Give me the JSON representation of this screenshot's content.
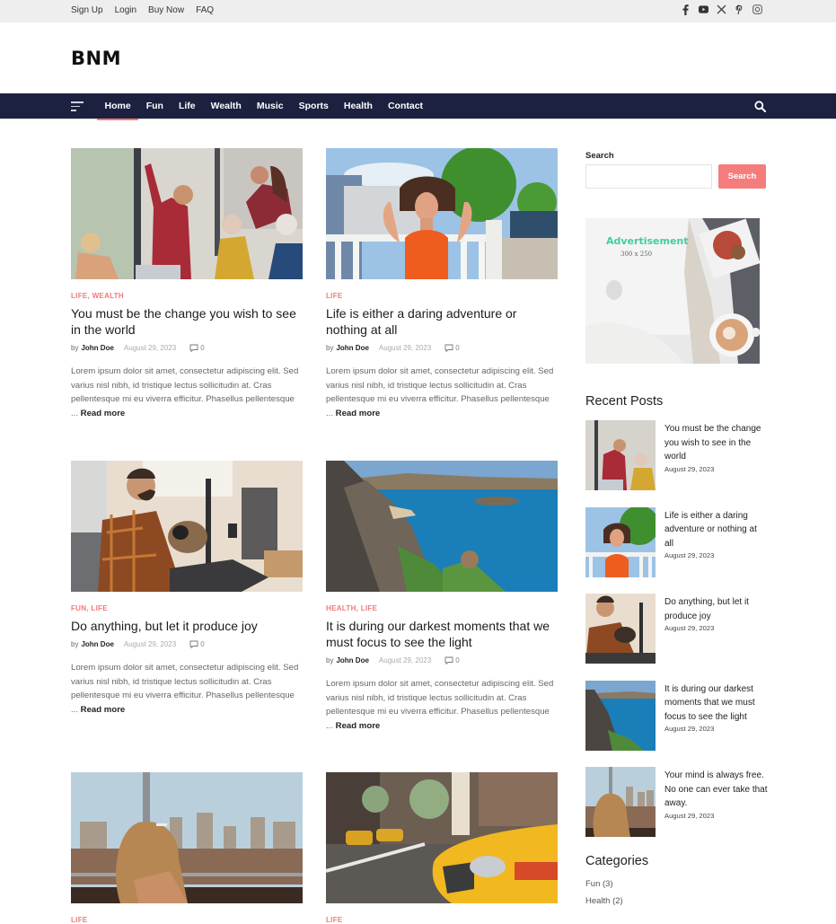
{
  "topbar": {
    "links": [
      "Sign Up",
      "Login",
      "Buy Now",
      "FAQ"
    ],
    "social": [
      "facebook-icon",
      "youtube-icon",
      "x-icon",
      "pinterest-icon",
      "instagram-icon"
    ]
  },
  "header": {
    "logo": "BNM"
  },
  "nav": {
    "items": [
      {
        "label": "Home",
        "active": true
      },
      {
        "label": "Fun"
      },
      {
        "label": "Life"
      },
      {
        "label": "Wealth"
      },
      {
        "label": "Music"
      },
      {
        "label": "Sports"
      },
      {
        "label": "Health"
      },
      {
        "label": "Contact"
      }
    ]
  },
  "colors": {
    "accent": "#f07a78",
    "nav_bg": "#1d2140",
    "button": "#f57c7c",
    "ad_text": "#3fcf9d"
  },
  "posts": [
    {
      "image": "people-celebrating-office",
      "categories": "LIFE, WEALTH",
      "title": "You must be the change you wish to see in the world",
      "by": "by",
      "author": "John Doe",
      "date": "August 29, 2023",
      "comments": "0",
      "excerpt": "Lorem ipsum dolor sit amet, consectetur adipiscing elit. Sed varius nisl nibh, id tristique lectus sollicitudin at. Cras pellentesque mi eu viverra efficitur. Phasellus pellentesque ...",
      "read_more": "Read more"
    },
    {
      "image": "woman-orange-top-fence",
      "categories": "LIFE",
      "title": "Life is either a daring adventure or nothing at all",
      "by": "by",
      "author": "John Doe",
      "date": "August 29, 2023",
      "comments": "0",
      "excerpt": "Lorem ipsum dolor sit amet, consectetur adipiscing elit. Sed varius nisl nibh, id tristique lectus sollicitudin at. Cras pellentesque mi eu viverra efficitur. Phasellus pellentesque ...",
      "read_more": "Read more"
    },
    {
      "image": "man-with-dog-phone",
      "categories": "FUN, LIFE",
      "title": "Do anything, but let it produce joy",
      "by": "by",
      "author": "John Doe",
      "date": "August 29, 2023",
      "comments": "0",
      "excerpt": "Lorem ipsum dolor sit amet, consectetur adipiscing elit. Sed varius nisl nibh, id tristique lectus sollicitudin at. Cras pellentesque mi eu viverra efficitur. Phasellus pellentesque ...",
      "read_more": "Read more"
    },
    {
      "image": "coastal-cliffs-sea",
      "categories": "HEALTH, LIFE",
      "title": "It is during our darkest moments that we must focus to see the light",
      "by": "by",
      "author": "John Doe",
      "date": "August 29, 2023",
      "comments": "0",
      "excerpt": "Lorem ipsum dolor sit amet, consectetur adipiscing elit. Sed varius nisl nibh, id tristique lectus sollicitudin at. Cras pellentesque mi eu viverra efficitur. Phasellus pellentesque ...",
      "read_more": "Read more"
    },
    {
      "image": "woman-city-skyline",
      "categories": "LIFE"
    },
    {
      "image": "yellow-taxi-street",
      "categories": "LIFE"
    }
  ],
  "sidebar": {
    "search_label": "Search",
    "search_value": "",
    "search_button": "Search",
    "ad_title": "Advertisement",
    "ad_size": "300 x 250",
    "recent_heading": "Recent Posts",
    "recent": [
      {
        "title": "You must be the change you wish to see in the world",
        "date": "August 29, 2023"
      },
      {
        "title": "Life is either a daring adventure or nothing at all",
        "date": "August 29, 2023"
      },
      {
        "title": "Do anything, but let it produce joy",
        "date": "August 29, 2023"
      },
      {
        "title": "It is during our darkest moments that we must focus to see the light",
        "date": "August 29, 2023"
      },
      {
        "title": "Your mind is always free. No one can ever take that away.",
        "date": "August 29, 2023"
      }
    ],
    "categories_heading": "Categories",
    "categories": [
      "Fun (3)",
      "Health (2)"
    ]
  }
}
